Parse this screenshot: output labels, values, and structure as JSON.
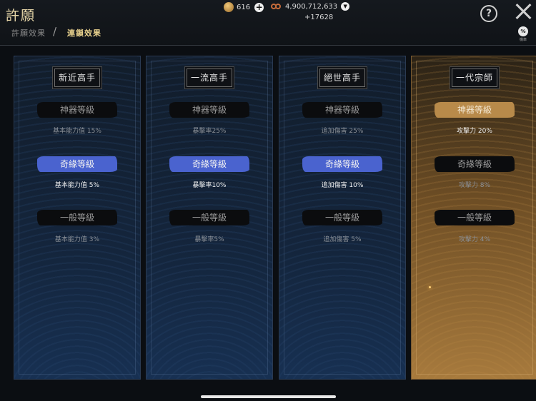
{
  "header": {
    "title": "許願",
    "tabs": [
      {
        "label": "許願效果",
        "active": false
      },
      {
        "label": "連鎖效果",
        "active": true
      }
    ],
    "separator": "/",
    "currency": {
      "coins": "616",
      "beads": "4,900,712,633",
      "beads_gain": "+17628"
    },
    "help_glyph": "?",
    "percent_glyph": "%",
    "percent_label": "機率"
  },
  "panels": [
    {
      "title": "新近高手",
      "tiers": [
        {
          "name": "神器等級",
          "stat": "基本能力值 15%"
        },
        {
          "name": "奇緣等級",
          "stat": "基本能力值 5%"
        },
        {
          "name": "一般等級",
          "stat": "基本能力值 3%"
        }
      ]
    },
    {
      "title": "一流高手",
      "tiers": [
        {
          "name": "神器等級",
          "stat": "暴擊率25%"
        },
        {
          "name": "奇緣等級",
          "stat": "暴擊率10%"
        },
        {
          "name": "一般等級",
          "stat": "暴擊率5%"
        }
      ]
    },
    {
      "title": "絕世高手",
      "tiers": [
        {
          "name": "神器等級",
          "stat": "追加傷害 25%"
        },
        {
          "name": "奇緣等級",
          "stat": "追加傷害 10%"
        },
        {
          "name": "一般等級",
          "stat": "追加傷害 5%"
        }
      ]
    },
    {
      "title": "一代宗師",
      "tiers": [
        {
          "name": "神器等級",
          "stat": "攻擊力 20%"
        },
        {
          "name": "奇緣等級",
          "stat": "攻擊力 8%"
        },
        {
          "name": "一般等級",
          "stat": "攻擊力 4%"
        }
      ]
    }
  ],
  "colors": {
    "highlight_blue": "#4a63cf",
    "highlight_gold": "#b88a4a",
    "title_gold": "#e6d6a8"
  }
}
